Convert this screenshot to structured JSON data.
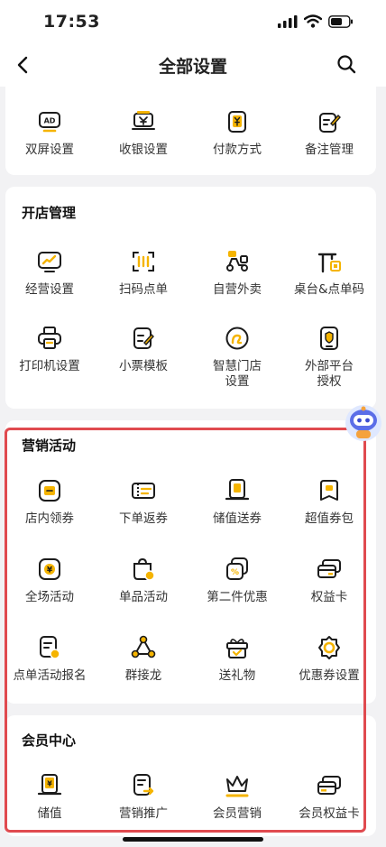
{
  "status": {
    "time": "17:53"
  },
  "nav": {
    "title": "全部设置"
  },
  "sections": {
    "top": {
      "items": [
        {
          "label": "双屏设置",
          "icon": "ad-screen-icon"
        },
        {
          "label": "收银设置",
          "icon": "cashier-icon"
        },
        {
          "label": "付款方式",
          "icon": "payment-method-icon"
        },
        {
          "label": "备注管理",
          "icon": "note-edit-icon"
        }
      ]
    },
    "shop": {
      "title": "开店管理",
      "items": [
        {
          "label": "经营设置",
          "icon": "business-chart-icon"
        },
        {
          "label": "扫码点单",
          "icon": "scan-order-icon"
        },
        {
          "label": "自营外卖",
          "icon": "delivery-scooter-icon"
        },
        {
          "label": "桌台&点单码",
          "icon": "table-qrcode-icon"
        },
        {
          "label": "打印机设置",
          "icon": "printer-icon"
        },
        {
          "label": "小票模板",
          "icon": "receipt-template-icon"
        },
        {
          "label": "智慧门店",
          "label2": "设置",
          "icon": "smart-store-icon"
        },
        {
          "label": "外部平台",
          "label2": "授权",
          "icon": "platform-auth-icon"
        }
      ]
    },
    "marketing": {
      "title": "营销活动",
      "items": [
        {
          "label": "店内领券",
          "icon": "store-coupon-icon"
        },
        {
          "label": "下单返券",
          "icon": "order-coupon-icon"
        },
        {
          "label": "储值送券",
          "icon": "stored-value-coupon-icon"
        },
        {
          "label": "超值券包",
          "icon": "coupon-pack-icon"
        },
        {
          "label": "全场活动",
          "icon": "store-wide-icon"
        },
        {
          "label": "单品活动",
          "icon": "item-promo-icon"
        },
        {
          "label": "第二件优惠",
          "icon": "second-item-discount-icon"
        },
        {
          "label": "权益卡",
          "icon": "benefit-card-icon"
        },
        {
          "label": "点单活动报名",
          "icon": "activity-signup-icon"
        },
        {
          "label": "群接龙",
          "icon": "group-relay-icon"
        },
        {
          "label": "送礼物",
          "icon": "gift-icon"
        },
        {
          "label": "优惠券设置",
          "icon": "coupon-settings-icon"
        }
      ]
    },
    "member": {
      "title": "会员中心",
      "items": [
        {
          "label": "储值",
          "icon": "stored-value-icon"
        },
        {
          "label": "营销推广",
          "icon": "promotion-icon"
        },
        {
          "label": "会员营销",
          "icon": "member-crown-icon"
        },
        {
          "label": "会员权益卡",
          "icon": "member-card-icon"
        }
      ]
    }
  },
  "colors": {
    "accent": "#f5b400",
    "highlight": "#e04a4f",
    "icon_stroke": "#1c1c1c"
  }
}
